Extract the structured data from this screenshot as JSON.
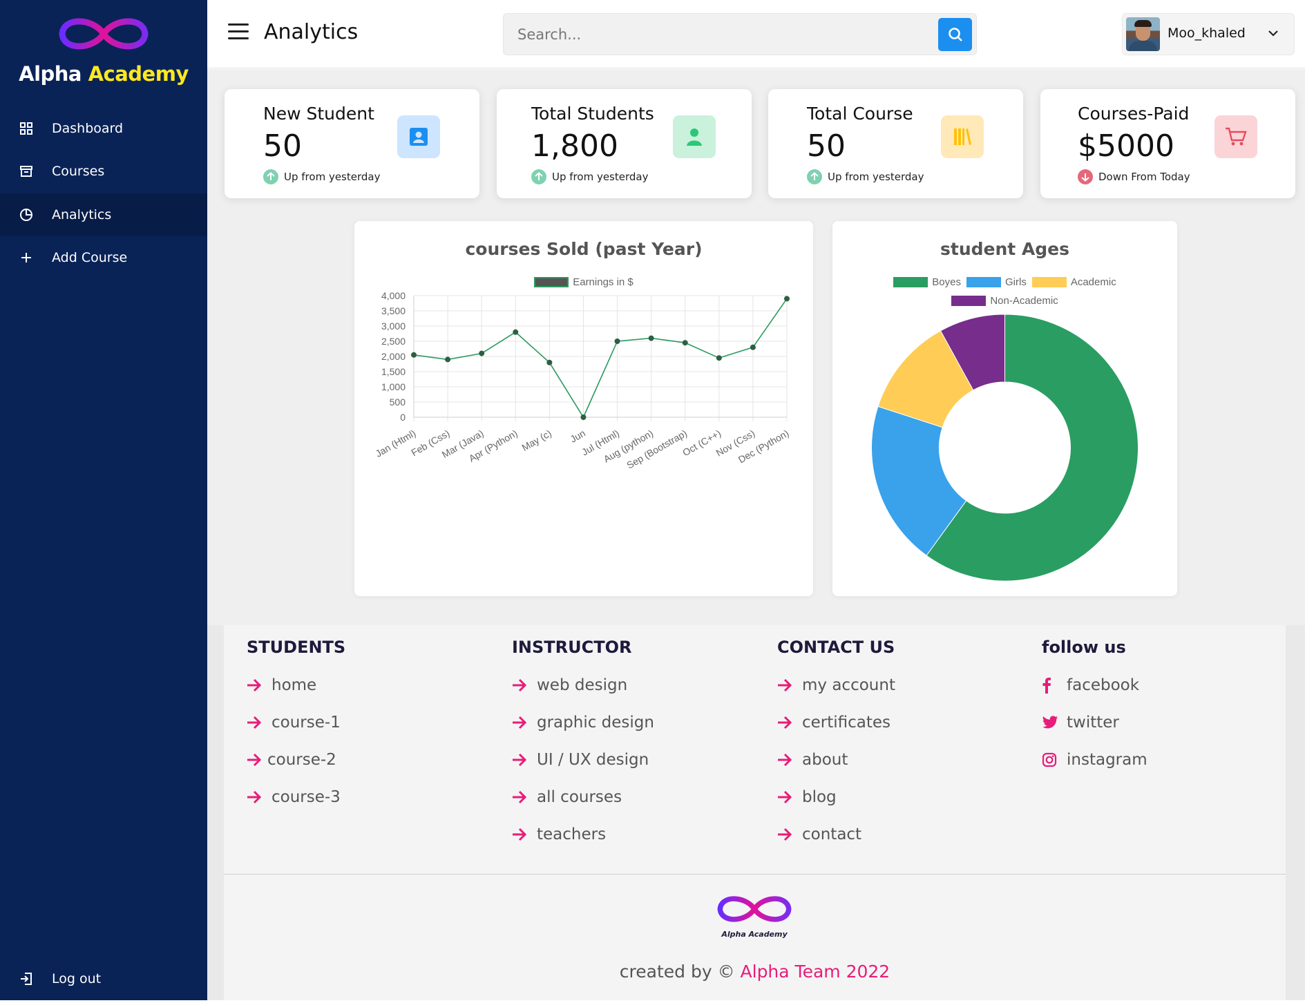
{
  "sidebar": {
    "brand_part1": "Alpha",
    "brand_part2": "Academy",
    "items": [
      {
        "label": "Dashboard",
        "icon": "grid-icon",
        "active": false
      },
      {
        "label": "Courses",
        "icon": "archive-icon",
        "active": false
      },
      {
        "label": "Analytics",
        "icon": "pie-chart-icon",
        "active": true
      },
      {
        "label": "Add Course",
        "icon": "plus-icon",
        "active": false
      }
    ],
    "logout_label": "Log out",
    "logout_icon": "logout-icon"
  },
  "header": {
    "title": "Analytics",
    "search_placeholder": "Search...",
    "user_name": "Moo_khaled",
    "search_button_color": "#1b8ff0"
  },
  "stats": [
    {
      "title": "New Student",
      "value": "50",
      "trend": "Up from yesterday",
      "direction": "up",
      "icon": "user-card-icon",
      "color": "#1b8ff0",
      "bg": "#cde5ff"
    },
    {
      "title": "Total Students",
      "value": "1,800",
      "trend": "Up from yesterday",
      "direction": "up",
      "icon": "user-icon",
      "color": "#2bc875",
      "bg": "#c9f1dc"
    },
    {
      "title": "Total Course",
      "value": "50",
      "trend": "Up from yesterday",
      "direction": "up",
      "icon": "books-icon",
      "color": "#ffc107",
      "bg": "#ffe9b8"
    },
    {
      "title": "Courses-Paid",
      "value": "$5000",
      "trend": "Down From Today",
      "direction": "down",
      "icon": "cart-icon",
      "color": "#e74c5b",
      "bg": "#fbd4d8"
    }
  ],
  "chart_data": [
    {
      "type": "line",
      "title": "courses Sold (past Year)",
      "categories": [
        "Jan (Html)",
        "Feb (Css)",
        "Mar (Java)",
        "Apr (Python)",
        "May (c)",
        "Jun",
        "Jul (Html)",
        "Aug (python)",
        "Sep (Bootstrap)",
        "Oct (C++)",
        "Nov (Css)",
        "Dec (Python)"
      ],
      "series": [
        {
          "name": "Earnings in $",
          "values": [
            2050,
            1900,
            2100,
            2800,
            1800,
            0,
            2500,
            2600,
            2450,
            1950,
            2300,
            3900
          ],
          "color": "#2a9a5f",
          "point_color": "#2e5e44"
        }
      ],
      "ylim": [
        0,
        4000
      ],
      "yticks": [
        "0",
        "500",
        "1,000",
        "1,500",
        "2,000",
        "2,500",
        "3,000",
        "3,500",
        "4,000"
      ],
      "grid": true,
      "legend_position": "top",
      "legend_swatch_color": "#555555"
    },
    {
      "type": "pie",
      "title": "student Ages",
      "categories": [
        "Boyes",
        "Girls",
        "Academic",
        "Non-Academic"
      ],
      "values": [
        60,
        20,
        12,
        8
      ],
      "colors": [
        "#2a9d62",
        "#39a2eb",
        "#ffcc55",
        "#772d8b"
      ],
      "legend_position": "top",
      "style": "doughnut"
    }
  ],
  "footer": {
    "columns": [
      {
        "heading": "STUDENTS",
        "links": [
          "home",
          "course-1",
          "course-2",
          "course-3"
        ]
      },
      {
        "heading": "INSTRUCTOR",
        "links": [
          "web design",
          "graphic design",
          "UI / UX design",
          "all courses",
          "teachers"
        ]
      },
      {
        "heading": "CONTACT US",
        "links": [
          "my account",
          "certificates",
          "about",
          "blog",
          "contact"
        ]
      },
      {
        "heading": "follow us",
        "links": [
          "facebook",
          "twitter",
          "instagram"
        ],
        "icons": [
          "facebook-icon",
          "twitter-icon",
          "instagram-icon"
        ]
      }
    ],
    "logo_text": "Alpha Academy",
    "credit_prefix": "created by © ",
    "credit_team": "Alpha Team 2022",
    "accent_color": "#e81c7a"
  }
}
